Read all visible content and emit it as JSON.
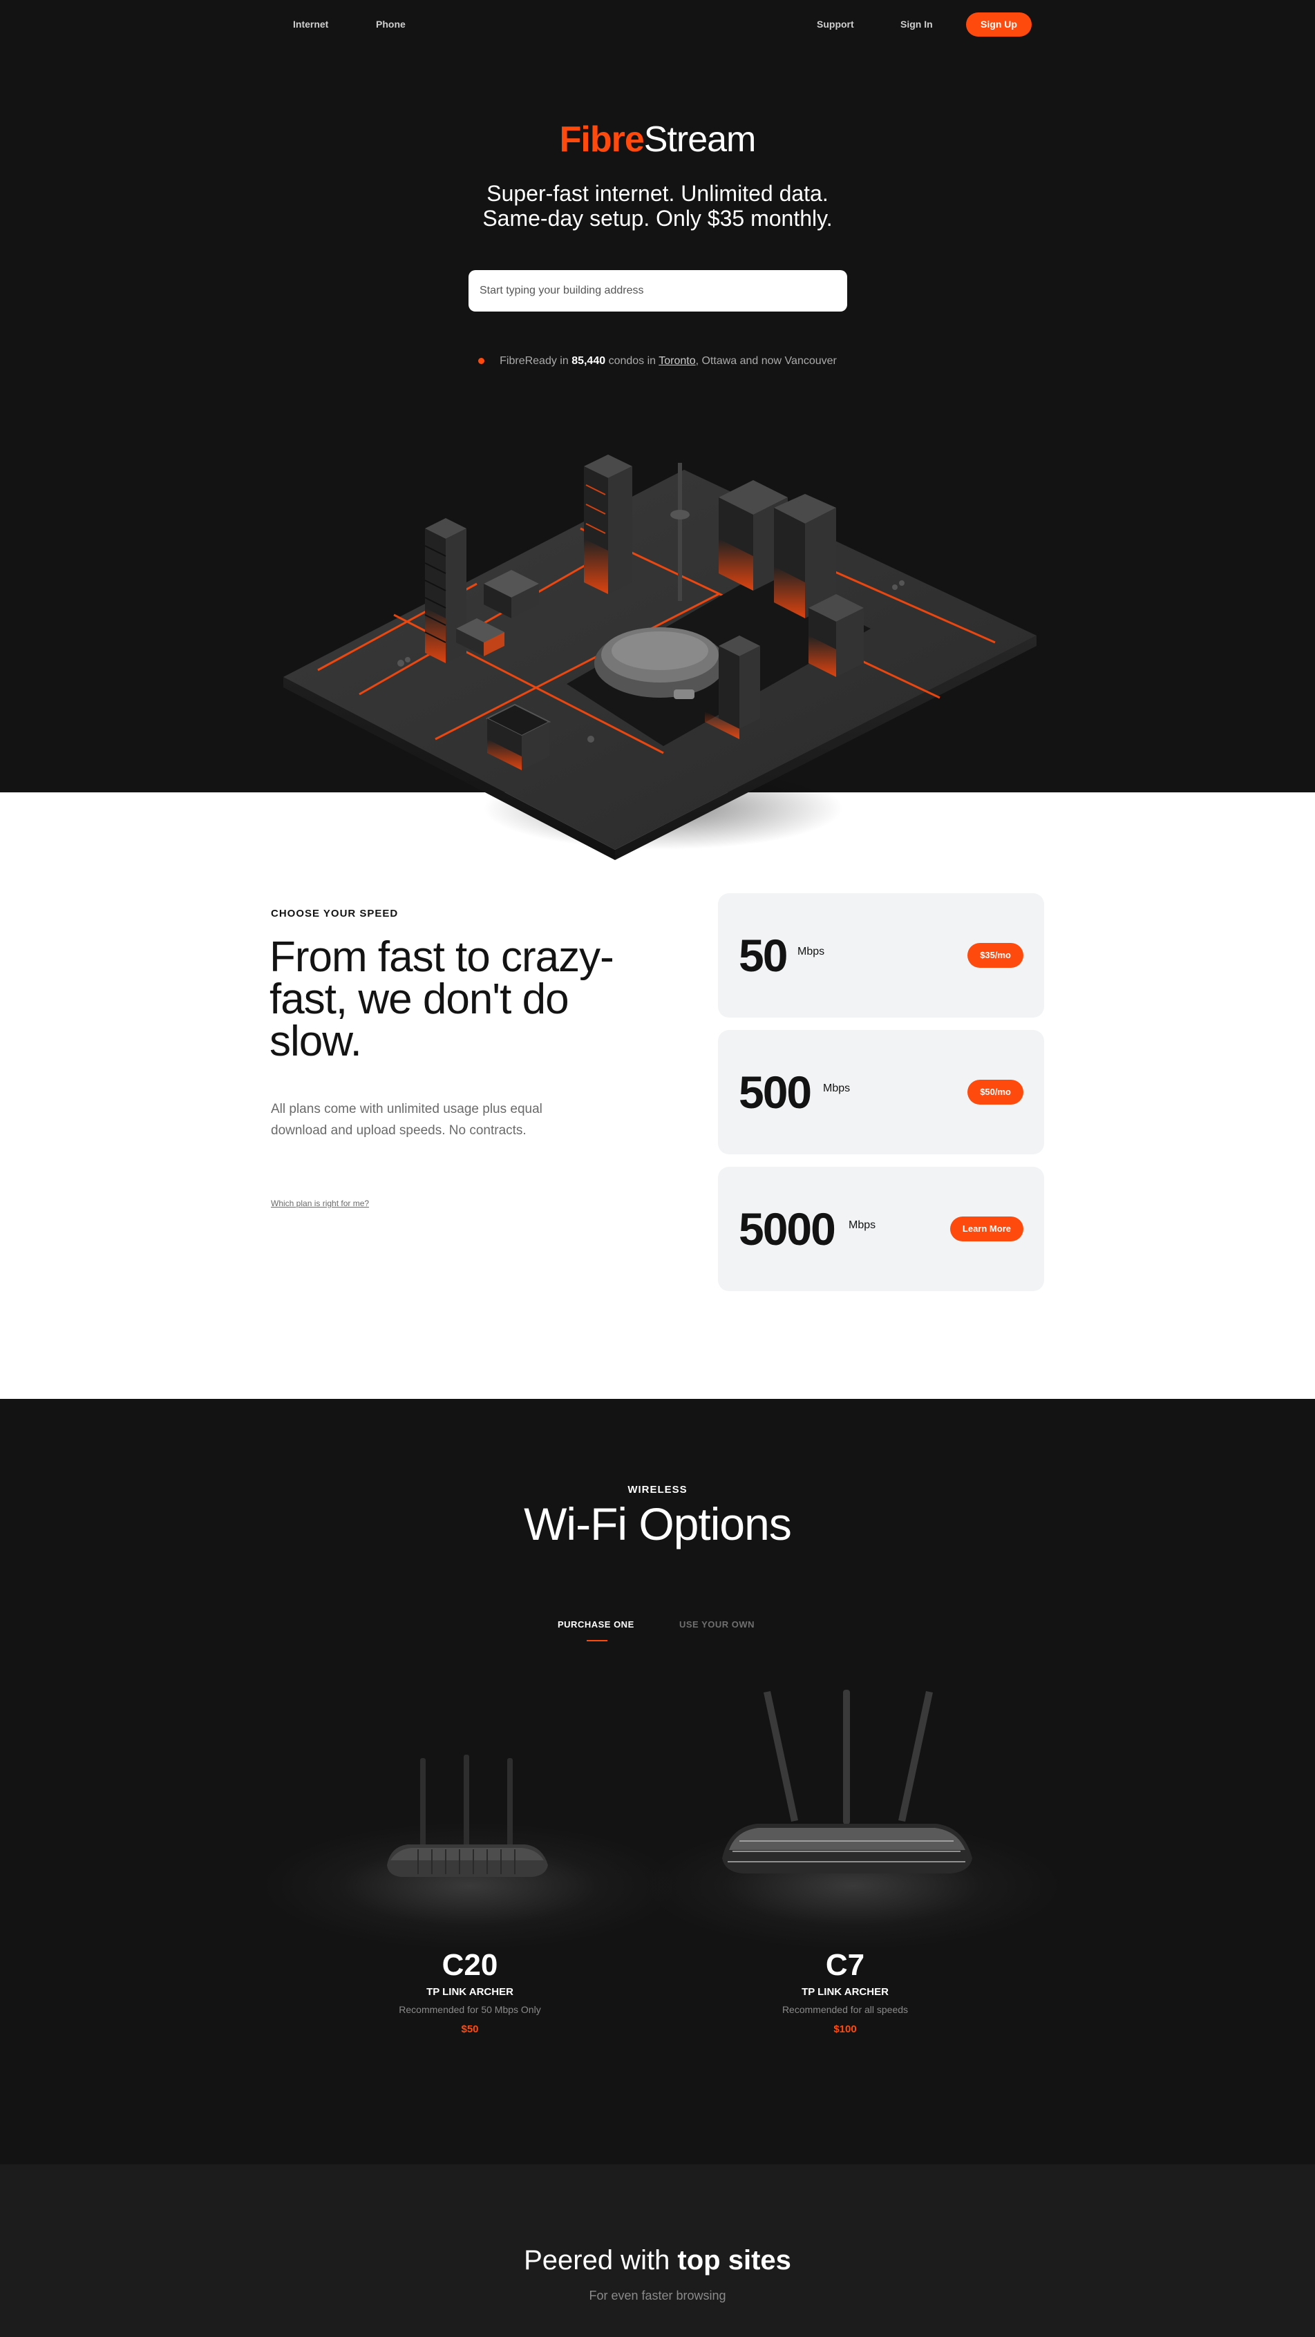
{
  "nav": {
    "internet": "Internet",
    "phone": "Phone",
    "support": "Support",
    "sign_in": "Sign In",
    "sign_up": "Sign Up"
  },
  "hero": {
    "brand_part1": "Fibre",
    "brand_part2": "Stream",
    "tagline_line1": "Super-fast internet. Unlimited data.",
    "tagline_line2": "Same-day setup. Only $35 monthly.",
    "search_placeholder": "Start typing your building address",
    "status_prefix": "FibreReady in ",
    "status_count": "85,440",
    "status_mid": " condos in ",
    "status_city_link": "Toronto",
    "status_suffix": ", Ottawa and now Vancouver"
  },
  "speed": {
    "eyebrow": "CHOOSE YOUR SPEED",
    "title": "From fast to crazy-fast, we don't do slow.",
    "description": "All plans come with unlimited usage plus equal download and upload speeds. No contracts.",
    "help_link": "Which plan is right for me?",
    "plans": [
      {
        "speed": "50",
        "unit": "Mbps",
        "cta": "$35/mo"
      },
      {
        "speed": "500",
        "unit": "Mbps",
        "cta": "$50/mo"
      },
      {
        "speed": "5000",
        "unit": "Mbps",
        "cta": "Learn More"
      }
    ]
  },
  "wifi": {
    "eyebrow": "WIRELESS",
    "title": "Wi-Fi Options",
    "tabs": [
      {
        "label": "PURCHASE ONE",
        "active": true
      },
      {
        "label": "USE YOUR OWN",
        "active": false
      }
    ],
    "products": [
      {
        "model": "C20",
        "brand": "TP LINK ARCHER",
        "note": "Recommended for 50 Mbps Only",
        "price": "$50"
      },
      {
        "model": "C7",
        "brand": "TP LINK ARCHER",
        "note": "Recommended for all speeds",
        "price": "$100"
      }
    ]
  },
  "peered": {
    "title_prefix": "Peered with ",
    "title_bold": "top sites",
    "subtitle": "For even faster browsing"
  },
  "colors": {
    "accent": "#ff4a0d",
    "dark_bg": "#131313",
    "light_card": "#f2f3f5"
  }
}
